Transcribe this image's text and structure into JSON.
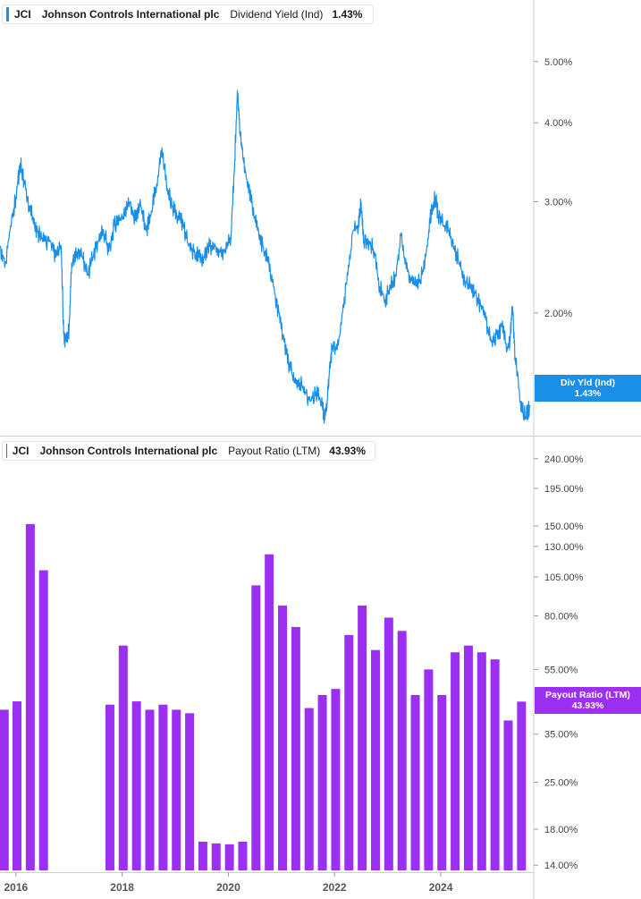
{
  "panels": {
    "top": {
      "ticker": "JCI",
      "company": "Johnson Controls International plc",
      "metric": "Dividend Yield (Ind)",
      "value": "1.43%",
      "tag_label": "Div Yld (Ind)",
      "tag_value": "1.43%",
      "color": "#1a8fe8"
    },
    "bottom": {
      "ticker": "JCI",
      "company": "Johnson Controls International plc",
      "metric": "Payout Ratio (LTM)",
      "value": "43.93%",
      "tag_label": "Payout Ratio (LTM)",
      "tag_value": "43.93%",
      "color": "#9b30f2"
    }
  },
  "x_axis_labels": [
    "2016",
    "2018",
    "2020",
    "2022",
    "2024"
  ],
  "chart_data": [
    {
      "type": "line",
      "scale": "log",
      "ylim": [
        1.3,
        5.6
      ],
      "y_ticks": [
        5.0,
        4.0,
        3.0,
        2.0
      ],
      "y_tick_labels": [
        "5.00%",
        "4.00%",
        "3.00%",
        "2.00%"
      ],
      "xlim": [
        2015.7,
        2025.75
      ],
      "series": [
        {
          "x": [
            2015.7,
            2015.8,
            2015.9,
            2016.0,
            2016.08,
            2016.15,
            2016.25,
            2016.35,
            2016.45,
            2016.55,
            2016.65,
            2016.75,
            2016.85,
            2016.9,
            2016.95,
            2017.0,
            2017.05,
            2017.15,
            2017.25,
            2017.35,
            2017.45,
            2017.55,
            2017.65,
            2017.75,
            2017.85,
            2017.95,
            2018.05,
            2018.15,
            2018.25,
            2018.35,
            2018.45,
            2018.55,
            2018.65,
            2018.75,
            2018.85,
            2018.95,
            2019.05,
            2019.15,
            2019.25,
            2019.35,
            2019.45,
            2019.55,
            2019.65,
            2019.75,
            2019.85,
            2019.95,
            2020.05,
            2020.12,
            2020.17,
            2020.22,
            2020.28,
            2020.35,
            2020.45,
            2020.55,
            2020.65,
            2020.75,
            2020.85,
            2020.95,
            2021.05,
            2021.15,
            2021.25,
            2021.35,
            2021.45,
            2021.55,
            2021.65,
            2021.75,
            2021.8,
            2021.85,
            2021.9,
            2021.95,
            2022.05,
            2022.15,
            2022.25,
            2022.35,
            2022.45,
            2022.5,
            2022.55,
            2022.65,
            2022.75,
            2022.85,
            2022.95,
            2023.05,
            2023.15,
            2023.25,
            2023.35,
            2023.45,
            2023.55,
            2023.65,
            2023.75,
            2023.82,
            2023.9,
            2023.95,
            2024.05,
            2024.15,
            2024.25,
            2024.35,
            2024.45,
            2024.55,
            2024.65,
            2024.75,
            2024.85,
            2024.95,
            2025.05,
            2025.15,
            2025.25,
            2025.3,
            2025.35,
            2025.4,
            2025.5,
            2025.6,
            2025.68
          ],
          "y": [
            2.55,
            2.4,
            2.75,
            3.05,
            3.45,
            3.25,
            2.95,
            2.75,
            2.65,
            2.6,
            2.6,
            2.45,
            2.55,
            1.85,
            1.8,
            1.88,
            2.4,
            2.5,
            2.45,
            2.3,
            2.45,
            2.6,
            2.7,
            2.5,
            2.75,
            2.8,
            2.85,
            3.0,
            2.8,
            2.95,
            2.7,
            2.9,
            3.2,
            3.65,
            3.15,
            2.95,
            2.85,
            2.75,
            2.55,
            2.5,
            2.45,
            2.45,
            2.55,
            2.55,
            2.5,
            2.5,
            2.65,
            3.5,
            4.5,
            3.85,
            3.5,
            3.25,
            2.95,
            2.7,
            2.55,
            2.4,
            2.2,
            2.0,
            1.8,
            1.65,
            1.55,
            1.55,
            1.5,
            1.45,
            1.5,
            1.45,
            1.38,
            1.4,
            1.6,
            1.75,
            1.75,
            2.0,
            2.3,
            2.7,
            2.75,
            3.0,
            2.6,
            2.6,
            2.5,
            2.2,
            2.1,
            2.2,
            2.3,
            2.65,
            2.35,
            2.25,
            2.2,
            2.3,
            2.55,
            2.9,
            3.05,
            2.85,
            2.75,
            2.7,
            2.55,
            2.4,
            2.25,
            2.2,
            2.15,
            2.05,
            1.95,
            1.8,
            1.85,
            1.9,
            1.75,
            1.8,
            2.05,
            1.7,
            1.45,
            1.37,
            1.43
          ]
        }
      ]
    },
    {
      "type": "bar",
      "scale": "log",
      "ylim": [
        13.5,
        260
      ],
      "y_ticks": [
        240,
        195,
        150,
        130,
        105,
        80,
        55,
        35,
        25,
        18,
        14
      ],
      "y_tick_labels": [
        "240.00%",
        "195.00%",
        "150.00%",
        "130.00%",
        "105.00%",
        "80.00%",
        "55.00%",
        "35.00%",
        "25.00%",
        "18.00%",
        "14.00%"
      ],
      "xlim": [
        2015.7,
        2025.75
      ],
      "series": [
        {
          "x": [
            2015.78,
            2016.02,
            2016.27,
            2016.52,
            2017.77,
            2018.02,
            2018.27,
            2018.52,
            2018.77,
            2019.02,
            2019.27,
            2019.52,
            2019.77,
            2020.02,
            2020.27,
            2020.52,
            2020.77,
            2021.02,
            2021.27,
            2021.52,
            2021.77,
            2022.02,
            2022.27,
            2022.52,
            2022.77,
            2023.02,
            2023.27,
            2023.52,
            2023.77,
            2024.02,
            2024.27,
            2024.52,
            2024.77,
            2025.02,
            2025.27,
            2025.52
          ],
          "values": [
            41.5,
            44,
            152,
            110,
            43,
            65,
            44,
            41.5,
            43,
            41.5,
            40.5,
            16.5,
            16.3,
            16.2,
            16.5,
            99,
            123,
            86,
            74,
            42,
            46,
            48,
            70,
            86,
            63,
            79,
            72,
            46,
            55,
            46,
            62,
            65,
            62,
            59,
            38.5,
            43.93
          ]
        }
      ]
    }
  ]
}
